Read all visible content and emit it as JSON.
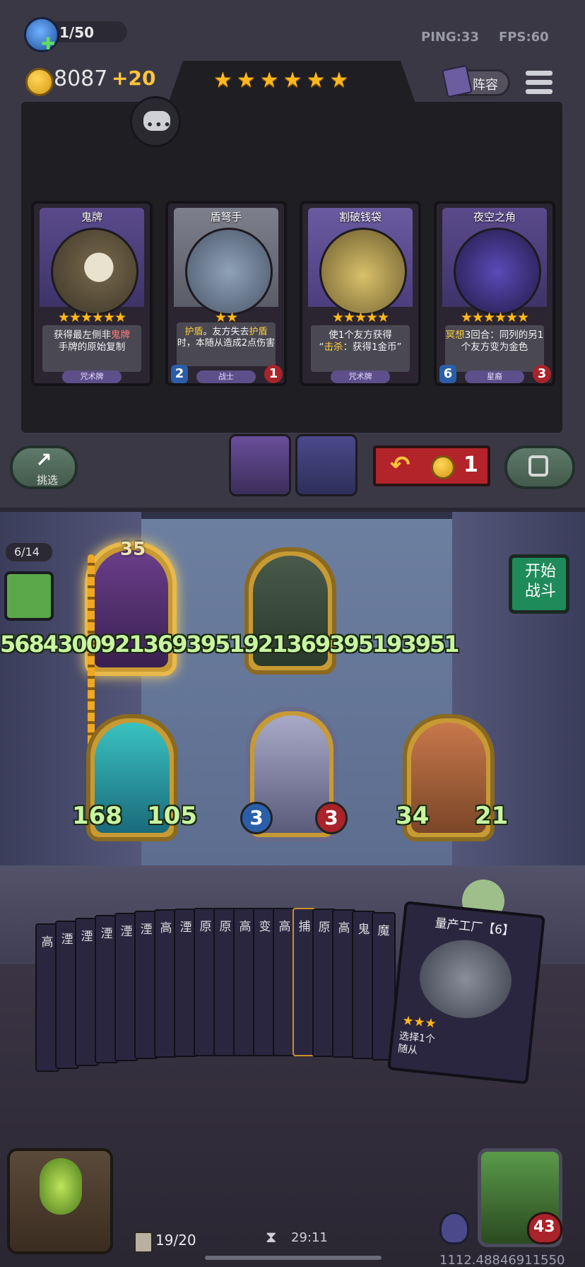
{
  "hud": {
    "player_count": "1/50",
    "ping": "PING:33",
    "fps": "FPS:60",
    "gold": "8087",
    "gold_gain": "+20",
    "tavern_stars": "★★★★★★",
    "lineup_label": "阵容"
  },
  "shop": {
    "cards": [
      {
        "name": "鬼牌",
        "stars": "★★★★★★",
        "desc_parts": [
          "获得最左侧非",
          "鬼牌",
          "手牌的原始复制"
        ],
        "type": "咒术牌",
        "attack": "",
        "health": ""
      },
      {
        "name": "盾弩手",
        "stars": "★★",
        "desc_parts": [
          "护盾",
          "。友方失去",
          "护盾",
          "时，本随从造成2点伤害"
        ],
        "type": "战士",
        "attack": "2",
        "health": "1"
      },
      {
        "name": "割破钱袋",
        "stars": "★★★★★",
        "desc_line1": "使1个友方获得",
        "desc_line2_hl": "击杀",
        "desc_line2": "：获得1金币”",
        "type": "咒术牌",
        "attack": "",
        "health": ""
      },
      {
        "name": "夜空之角",
        "stars": "★★★★★★",
        "desc_hl": "冥想",
        "desc_rest": "3回合：同列的另1个友方变为金色",
        "type": "星裔",
        "attack": "6",
        "health": "3"
      }
    ],
    "refresh_label": "挑选",
    "refresh_cost": "1"
  },
  "board": {
    "opponent_count": "6/14",
    "start_battle": "开始\n战斗",
    "front_row_stats": "5684300921369395192136939519395 1",
    "front_row_stat_text": "5684300921369395192136939519395",
    "front_row_stat_tail": "1",
    "level_badge": "35",
    "units": [
      {
        "atk": "168",
        "hp": "105"
      },
      {
        "atk": "3",
        "hp": "3"
      },
      {
        "atk": "34",
        "hp": "21"
      }
    ]
  },
  "hand": {
    "card_labels": [
      "高",
      "湮",
      "湮",
      "湮",
      "湮",
      "湮",
      "高",
      "湮",
      "原",
      "原",
      "高",
      "变",
      "高",
      "捕",
      "原",
      "高",
      "鬼",
      "魔"
    ],
    "featured_title": "量产工厂【6】",
    "featured_desc": "选择1个\n随从",
    "deck_count": "19/20",
    "timer": "29:11",
    "hero_health": "43",
    "footer_number": "1112.48846911550"
  },
  "colors": {
    "gold": "#ffb81c",
    "stat_green": "#c9f5a2",
    "danger_red": "#a8232a",
    "panel": "#3b3846"
  }
}
